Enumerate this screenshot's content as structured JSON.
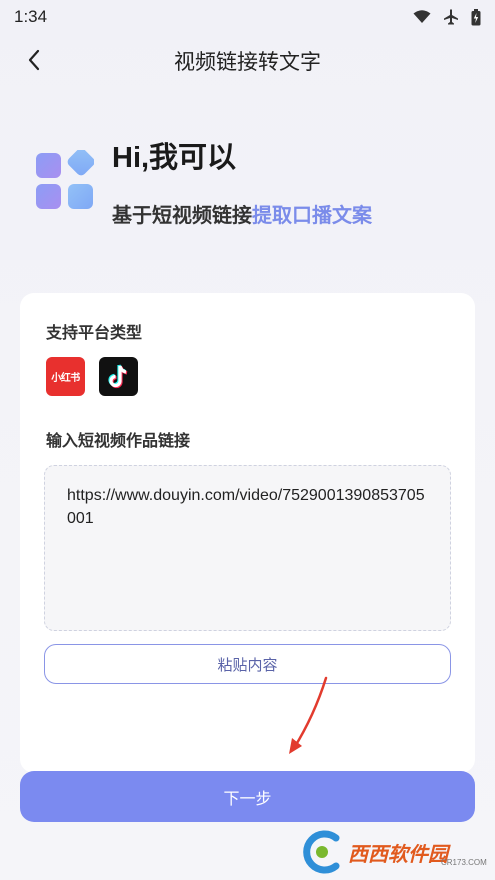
{
  "status": {
    "time": "1:34"
  },
  "nav": {
    "title": "视频链接转文字"
  },
  "hero": {
    "title": "Hi,我可以",
    "subtitle_plain": "基于短视频链接",
    "subtitle_highlight": "提取口播文案"
  },
  "card": {
    "platforms_label": "支持平台类型",
    "platforms": [
      {
        "name": "小红书",
        "icon": "xiaohongshu-logo"
      },
      {
        "name": "抖音",
        "icon": "douyin-logo"
      }
    ],
    "input_label": "输入短视频作品链接",
    "input_value": "https://www.douyin.com/video/7529001390853705001",
    "paste_label": "粘贴内容"
  },
  "next_label": "下一步",
  "watermark": {
    "text": "西西软件园",
    "url": "CR173.COM"
  },
  "colors": {
    "accent": "#7b8af0",
    "highlight": "#7b8cea",
    "xhs_red": "#e8302e"
  }
}
